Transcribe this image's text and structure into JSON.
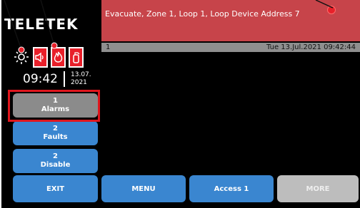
{
  "logo": {
    "text": "TELETEK"
  },
  "status": {
    "icons": [
      "sun-icon",
      "speaker-icon",
      "fire-icon",
      "fire-extinguisher-icon"
    ]
  },
  "clock": {
    "time": "09:42",
    "date_day_month": "13.07.",
    "date_year": "2021"
  },
  "side_buttons": [
    {
      "count": "1",
      "label": "Alarms"
    },
    {
      "count": "2",
      "label": "Faults"
    },
    {
      "count": "2",
      "label": "Disable"
    }
  ],
  "message": {
    "text": "Evacuate, Zone 1, Loop 1, Loop Device Address 7"
  },
  "info_bar": {
    "index": "1",
    "datetime": "Tue 13.Jul.2021 09:42:44"
  },
  "bottom_buttons": [
    {
      "label": "EXIT"
    },
    {
      "label": "MENU"
    },
    {
      "label": "Access 1"
    },
    {
      "label": "MORE",
      "disabled": true
    }
  ],
  "colors": {
    "alert": "#e8202a",
    "button": "#3a86d0",
    "selected": "#8b8b8b",
    "message_bg": "#c7444a"
  }
}
